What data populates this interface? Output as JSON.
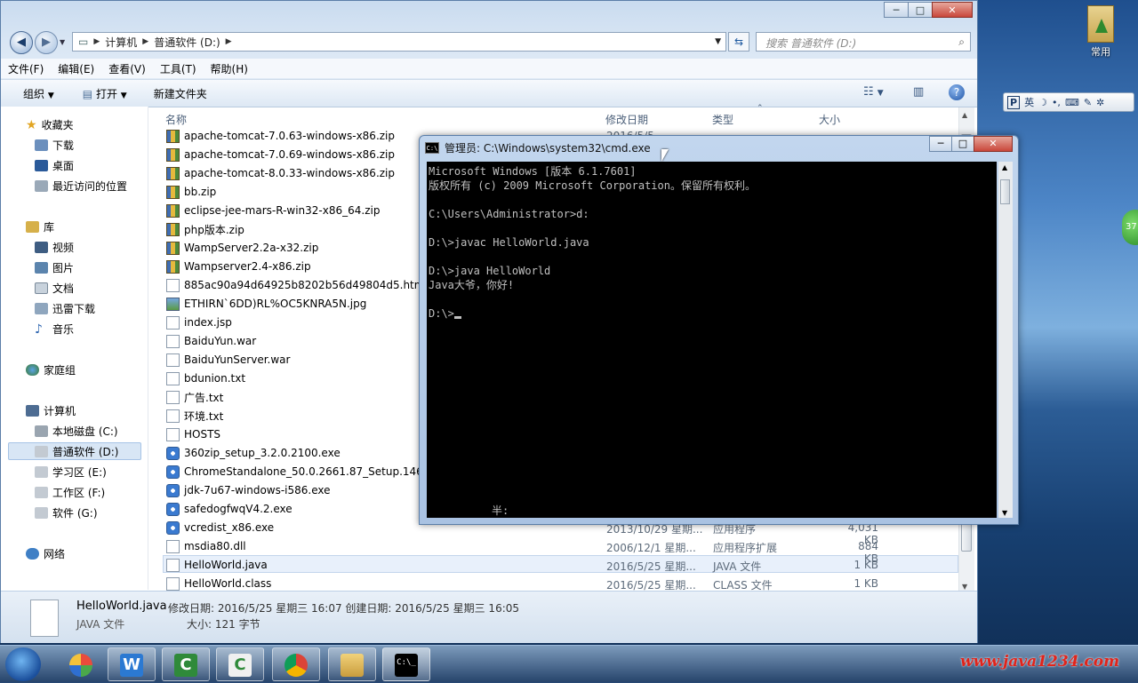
{
  "desktop": {
    "icon_label": "常用"
  },
  "ime_bar": {
    "mode": "英"
  },
  "side_badge": "37",
  "explorer": {
    "window_controls": [
      "─",
      "□",
      "✕"
    ],
    "breadcrumb": [
      "计算机",
      "普通软件 (D:)"
    ],
    "search_placeholder": "搜索 普通软件 (D:)",
    "menu": [
      "文件(F)",
      "编辑(E)",
      "查看(V)",
      "工具(T)",
      "帮助(H)"
    ],
    "toolbar": {
      "organize": "组织",
      "open": "打开",
      "new_folder": "新建文件夹"
    },
    "sidebar": {
      "favorites": "收藏夹",
      "favorites_items": [
        "下载",
        "桌面",
        "最近访问的位置"
      ],
      "libraries": "库",
      "library_items": [
        "视频",
        "图片",
        "文档",
        "迅雷下载",
        "音乐"
      ],
      "homegroup": "家庭组",
      "computer": "计算机",
      "drives": [
        "本地磁盘 (C:)",
        "普通软件 (D:)",
        "学习区 (E:)",
        "工作区 (F:)",
        "软件 (G:)"
      ],
      "network": "网络"
    },
    "columns": {
      "name": "名称",
      "modified": "修改日期",
      "type": "类型",
      "size": "大小"
    },
    "files": [
      {
        "name": "apache-tomcat-7.0.63-windows-x86.zip",
        "kind": "zip",
        "date": "2016/5/5",
        "type": "",
        "size": ""
      },
      {
        "name": "apache-tomcat-7.0.69-windows-x86.zip",
        "kind": "zip",
        "date": "",
        "type": "",
        "size": ""
      },
      {
        "name": "apache-tomcat-8.0.33-windows-x86.zip",
        "kind": "zip",
        "date": "",
        "type": "",
        "size": ""
      },
      {
        "name": "bb.zip",
        "kind": "zip",
        "date": "",
        "type": "",
        "size": ""
      },
      {
        "name": "eclipse-jee-mars-R-win32-x86_64.zip",
        "kind": "zip",
        "date": "",
        "type": "",
        "size": ""
      },
      {
        "name": "php版本.zip",
        "kind": "zip",
        "date": "",
        "type": "",
        "size": ""
      },
      {
        "name": "WampServer2.2a-x32.zip",
        "kind": "zip",
        "date": "",
        "type": "",
        "size": ""
      },
      {
        "name": "Wampserver2.4-x86.zip",
        "kind": "zip",
        "date": "",
        "type": "",
        "size": ""
      },
      {
        "name": "885ac90a94d64925b8202b56d49804d5.html",
        "kind": "doc",
        "date": "",
        "type": "",
        "size": ""
      },
      {
        "name": "ETHIRN`6DD)RL%OC5KNRA5N.jpg",
        "kind": "img",
        "date": "",
        "type": "",
        "size": ""
      },
      {
        "name": "index.jsp",
        "kind": "doc",
        "date": "",
        "type": "",
        "size": ""
      },
      {
        "name": "BaiduYun.war",
        "kind": "doc",
        "date": "",
        "type": "",
        "size": ""
      },
      {
        "name": "BaiduYunServer.war",
        "kind": "doc",
        "date": "",
        "type": "",
        "size": ""
      },
      {
        "name": "bdunion.txt",
        "kind": "doc",
        "date": "",
        "type": "",
        "size": ""
      },
      {
        "name": "广告.txt",
        "kind": "doc",
        "date": "",
        "type": "",
        "size": ""
      },
      {
        "name": "环境.txt",
        "kind": "doc",
        "date": "",
        "type": "",
        "size": ""
      },
      {
        "name": "HOSTS",
        "kind": "doc",
        "date": "",
        "type": "",
        "size": ""
      },
      {
        "name": "360zip_setup_3.2.0.2100.exe",
        "kind": "exe",
        "date": "",
        "type": "",
        "size": ""
      },
      {
        "name": "ChromeStandalone_50.0.2661.87_Setup.14613",
        "kind": "exe",
        "date": "",
        "type": "",
        "size": ""
      },
      {
        "name": "jdk-7u67-windows-i586.exe",
        "kind": "exe",
        "date": "",
        "type": "",
        "size": ""
      },
      {
        "name": "safedogfwqV4.2.exe",
        "kind": "exe",
        "date": "",
        "type": "",
        "size": ""
      },
      {
        "name": "vcredist_x86.exe",
        "kind": "exe",
        "date": "2013/10/29 星期...",
        "type": "应用程序",
        "size": "4,031 KB"
      },
      {
        "name": "msdia80.dll",
        "kind": "doc",
        "date": "2006/12/1 星期...",
        "type": "应用程序扩展",
        "size": "884 KB"
      },
      {
        "name": "HelloWorld.java",
        "kind": "doc",
        "date": "2016/5/25 星期...",
        "type": "JAVA 文件",
        "size": "1 KB"
      },
      {
        "name": "HelloWorld.class",
        "kind": "doc",
        "date": "2016/5/25 星期...",
        "type": "CLASS 文件",
        "size": "1 KB"
      }
    ],
    "selected_index": 23,
    "details": {
      "filename": "HelloWorld.java",
      "meta": "修改日期: 2016/5/25 星期三 16:07 创建日期: 2016/5/25 星期三 16:05",
      "filetype": "JAVA 文件",
      "size": "大小: 121 字节"
    }
  },
  "cmd": {
    "title": "管理员: C:\\Windows\\system32\\cmd.exe",
    "icon_text": "C:\\",
    "controls": [
      "─",
      "□",
      "✕"
    ],
    "lines": [
      "Microsoft Windows [版本 6.1.7601]",
      "版权所有 (c) 2009 Microsoft Corporation。保留所有权利。",
      "",
      "C:\\Users\\Administrator>d:",
      "",
      "D:\\>javac HelloWorld.java",
      "",
      "D:\\>java HelloWorld",
      "Java大爷，你好!",
      "",
      "D:\\>"
    ],
    "ime_state": "半:"
  },
  "taskbar": {
    "apps": [
      "W",
      "C",
      "C",
      "",
      "",
      "C:\\_"
    ]
  },
  "watermark": "www.java1234.com"
}
